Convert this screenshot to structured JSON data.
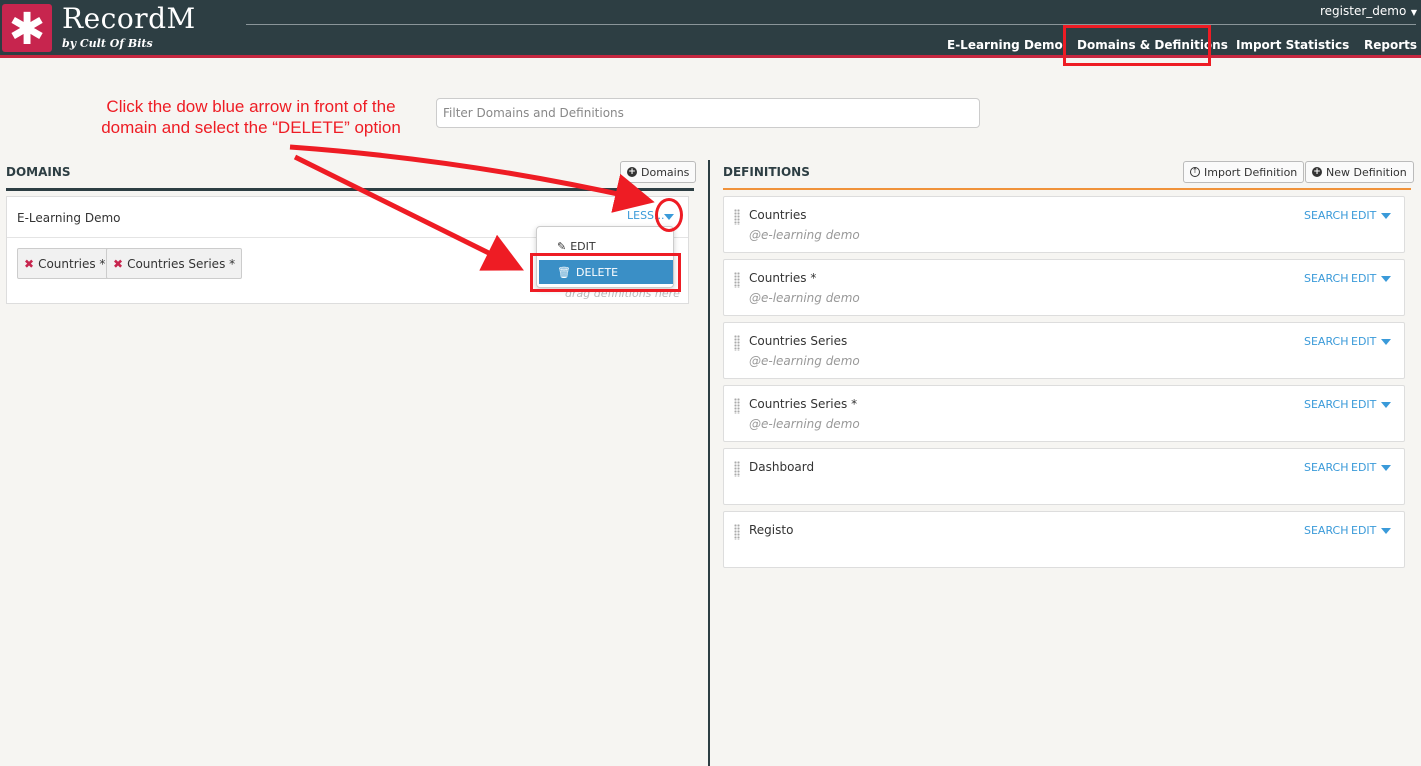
{
  "app": {
    "brand": "RecordM",
    "tagline": "by Cult Of Bits",
    "logo_icon": "asterisk-icon"
  },
  "user": {
    "name": "register_demo"
  },
  "nav": [
    {
      "label": "E-Learning Demo"
    },
    {
      "label": "Domains & Definitions",
      "active": true
    },
    {
      "label": "Import Statistics"
    },
    {
      "label": "Reports"
    }
  ],
  "filter": {
    "placeholder": "Filter Domains and Definitions",
    "value": ""
  },
  "annotation": {
    "text": "Click the dow blue arrow in front of the domain and select the “DELETE” option",
    "color": "#ee1c24"
  },
  "domains": {
    "title": "DOMAINS",
    "add_button": "Domains",
    "items": [
      {
        "name": "E-Learning Demo",
        "toggle_label": "LESS...",
        "tags": [
          "Countries *",
          "Countries Series *"
        ],
        "drag_hint": "drag definitions here"
      }
    ],
    "menu": {
      "edit": "EDIT",
      "delete": "DELETE"
    }
  },
  "definitions": {
    "title": "DEFINITIONS",
    "import_button": "Import Definition",
    "new_button": "New Definition",
    "search_label": "SEARCH",
    "edit_label": "EDIT",
    "items": [
      {
        "name": "Countries",
        "domain": "@e-learning demo"
      },
      {
        "name": "Countries *",
        "domain": "@e-learning demo"
      },
      {
        "name": "Countries Series",
        "domain": "@e-learning demo"
      },
      {
        "name": "Countries Series *",
        "domain": "@e-learning demo"
      },
      {
        "name": "Dashboard",
        "domain": ""
      },
      {
        "name": "Registo",
        "domain": ""
      }
    ]
  },
  "colors": {
    "header_bg": "#2d3e43",
    "accent_red": "#c7254e",
    "link_blue": "#3a9ad9",
    "orange_rule": "#f0923a"
  }
}
